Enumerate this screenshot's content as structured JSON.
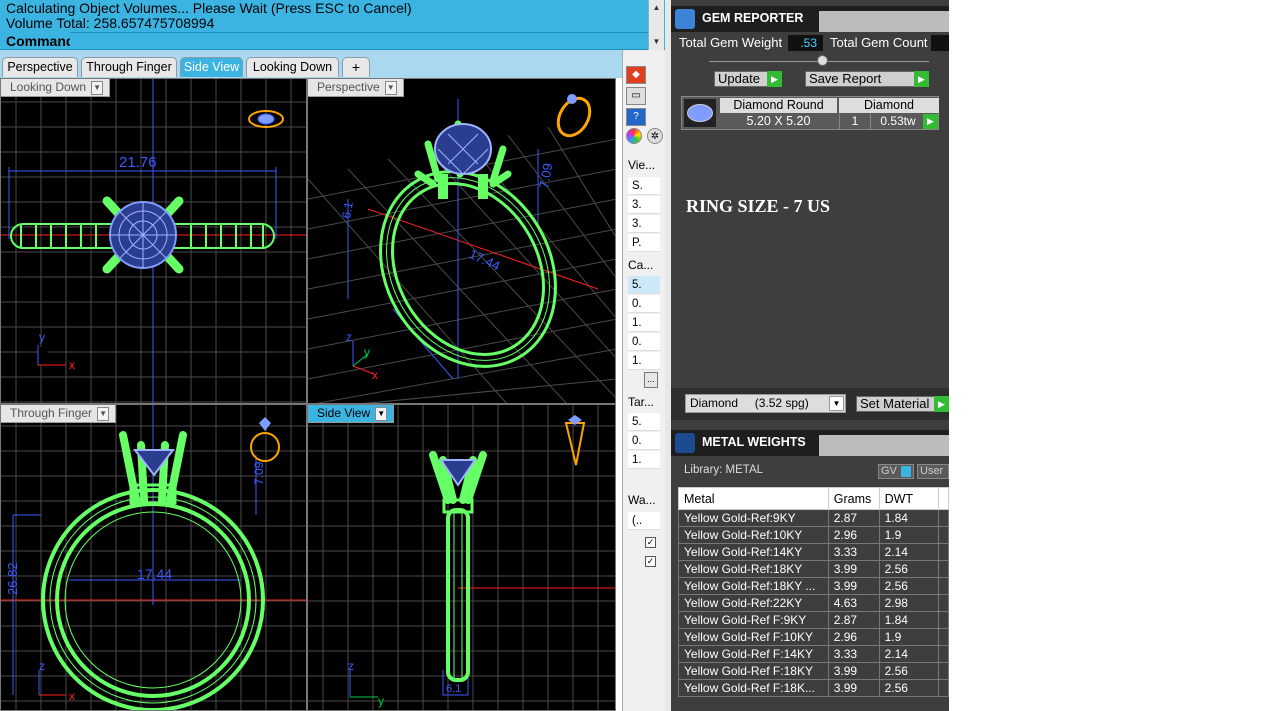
{
  "command": {
    "line1": "Calculating Object Volumes... Please Wait (Press ESC to Cancel)",
    "line2": "Volume Total: 258.657475708994",
    "prompt": "Command:"
  },
  "view_tabs": [
    {
      "label": "Perspective",
      "active": false
    },
    {
      "label": "Through Finger",
      "active": false
    },
    {
      "label": "Side View",
      "active": true
    },
    {
      "label": "Looking Down",
      "active": false
    }
  ],
  "add_tab_symbol": "+",
  "viewports": {
    "top_left": {
      "label": "Looking Down",
      "dim": "21.76",
      "axis_y": "y",
      "axis_x": "x"
    },
    "top_right": {
      "label": "Perspective",
      "dim_a": "7.09",
      "dim_b": "17.44",
      "dim_c": "6.1",
      "axis_z": "z",
      "axis_y": "y",
      "axis_x": "x"
    },
    "bottom_left": {
      "label": "Through Finger",
      "dim_a": "17.44",
      "dim_b": "26.82",
      "dim_c": "7.09",
      "axis_z": "z",
      "axis_x": "x"
    },
    "bottom_right": {
      "label": "Side View",
      "dim": "6.1",
      "axis_z": "z",
      "axis_y": "y"
    }
  },
  "sidebar": {
    "sections": [
      {
        "title": "Vie...",
        "rows": [
          "S.",
          "3.",
          "3.",
          "P."
        ]
      },
      {
        "title": "Ca...",
        "rows": [
          "5.",
          "0.",
          "1.",
          "0.",
          "1."
        ]
      },
      {
        "title": "Tar...",
        "rows": [
          "5.",
          "0.",
          "1."
        ]
      },
      {
        "title": "Wa...",
        "rows": [
          "(..",
          "",
          ""
        ]
      }
    ],
    "more_button": "..."
  },
  "gem_reporter": {
    "title": "GEM REPORTER",
    "total_weight_label": "Total Gem Weight",
    "total_weight_value": ".53",
    "total_count_label": "Total Gem Count",
    "update_label": "Update",
    "save_label": "Save Report",
    "gem": {
      "shape": "Diamond Round",
      "size": "5.20 X 5.20",
      "type": "Diamond",
      "count": "1",
      "weight": "0.53tw"
    },
    "note": "RING SIZE - 7 US",
    "material_select": "Diamond     (3.52 spg)",
    "set_material_label": "Set Material"
  },
  "metal_weights": {
    "title": "METAL WEIGHTS",
    "library_label": "Library: METAL",
    "gv_label": "GV",
    "user_label": "User",
    "columns": [
      "Metal",
      "Grams",
      "DWT"
    ],
    "rows": [
      [
        "Yellow Gold-Ref:9KY",
        "2.87",
        "1.84"
      ],
      [
        "Yellow Gold-Ref:10KY",
        "2.96",
        "1.9"
      ],
      [
        "Yellow Gold-Ref:14KY",
        "3.33",
        "2.14"
      ],
      [
        "Yellow Gold-Ref:18KY",
        "3.99",
        "2.56"
      ],
      [
        "Yellow Gold-Ref:18KY ...",
        "3.99",
        "2.56"
      ],
      [
        "Yellow Gold-Ref:22KY",
        "4.63",
        "2.98"
      ],
      [
        "Yellow Gold-Ref F:9KY",
        "2.87",
        "1.84"
      ],
      [
        "Yellow Gold-Ref F:10KY",
        "2.96",
        "1.9"
      ],
      [
        "Yellow Gold-Ref F:14KY",
        "3.33",
        "2.14"
      ],
      [
        "Yellow Gold-Ref F:18KY",
        "3.99",
        "2.56"
      ],
      [
        "Yellow Gold-Ref F:18K...",
        "3.99",
        "2.56"
      ]
    ]
  },
  "colors": {
    "accent": "#3cb4e2",
    "wire": "#66ff66",
    "gem": "#7f9cff",
    "grid": "#4a4a4a",
    "axis_red": "#ff2020",
    "axis_blue": "#3a5bff",
    "go_green": "#33bb33"
  }
}
